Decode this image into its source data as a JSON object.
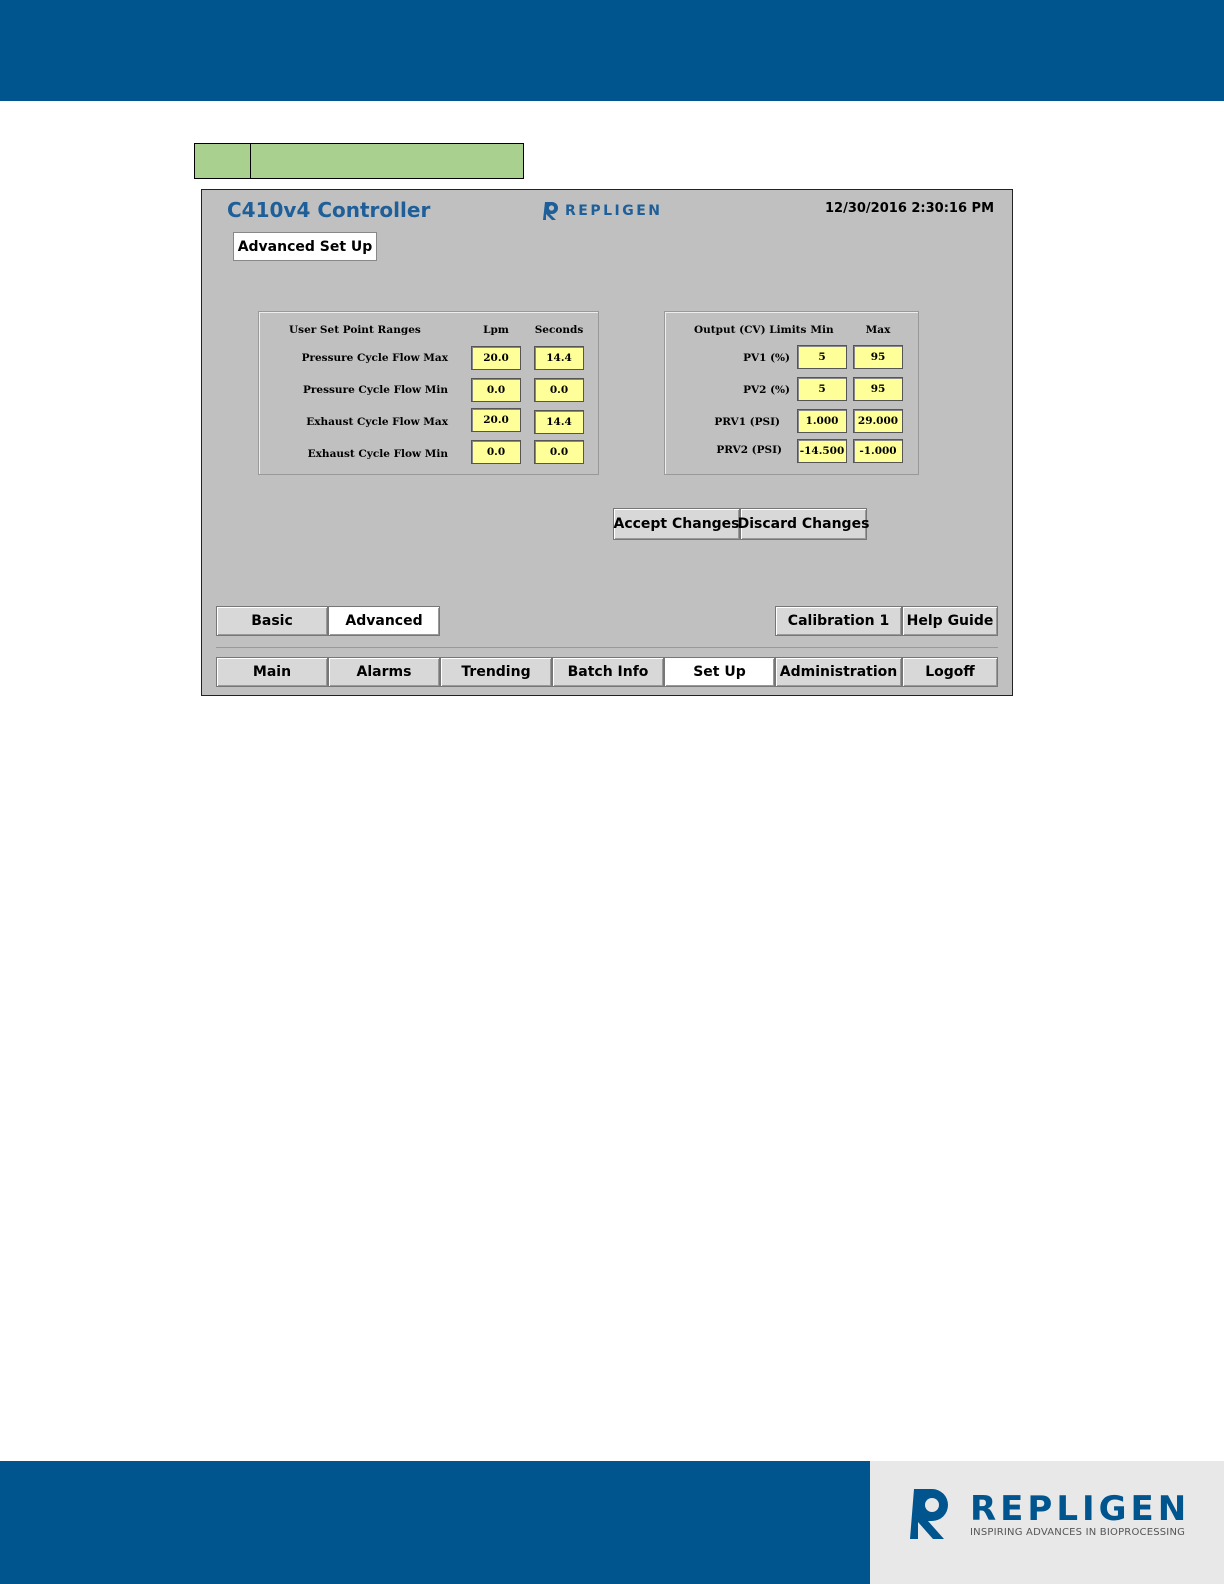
{
  "screen": {
    "title": "C410v4 Controller",
    "brand": "REPLIGEN",
    "datetime": "12/30/2016 2:30:16 PM",
    "page_tab": "Advanced Set Up"
  },
  "setpoints": {
    "heading": "User Set Point Ranges",
    "col_lpm": "Lpm",
    "col_seconds": "Seconds",
    "rows": [
      {
        "label": "Pressure Cycle Flow Max",
        "lpm": "20.0",
        "seconds": "14.4"
      },
      {
        "label": "Pressure Cycle Flow Min",
        "lpm": "0.0",
        "seconds": "0.0"
      },
      {
        "label": "Exhaust Cycle Flow Max",
        "lpm": "20.0",
        "seconds": "14.4"
      },
      {
        "label": "Exhaust Cycle Flow Min",
        "lpm": "0.0",
        "seconds": "0.0"
      }
    ]
  },
  "limits": {
    "heading": "Output (CV) Limits",
    "col_min": "Min",
    "col_max": "Max",
    "rows": [
      {
        "label": "PV1 (%)",
        "min": "5",
        "max": "95"
      },
      {
        "label": "PV2 (%)",
        "min": "5",
        "max": "95"
      },
      {
        "label": "PRV1 (PSI)",
        "min": "1.000",
        "max": "29.000"
      },
      {
        "label": "PRV2 (PSI)",
        "min": "-14.500",
        "max": "-1.000"
      }
    ]
  },
  "actions": {
    "accept": "Accept Changes",
    "discard": "Discard Changes"
  },
  "subtabs": {
    "basic": "Basic",
    "advanced": "Advanced",
    "calibration": "Calibration 1",
    "help": "Help Guide"
  },
  "nav": [
    "Main",
    "Alarms",
    "Trending",
    "Batch Info",
    "Set Up",
    "Administration",
    "Logoff"
  ],
  "footer": {
    "brand": "REPLIGEN",
    "tagline": "INSPIRING ADVANCES IN BIOPROCESSING"
  },
  "colors": {
    "brand_blue": "#00558f",
    "field_yellow": "#ffff99",
    "header_green": "#a9d08e"
  }
}
